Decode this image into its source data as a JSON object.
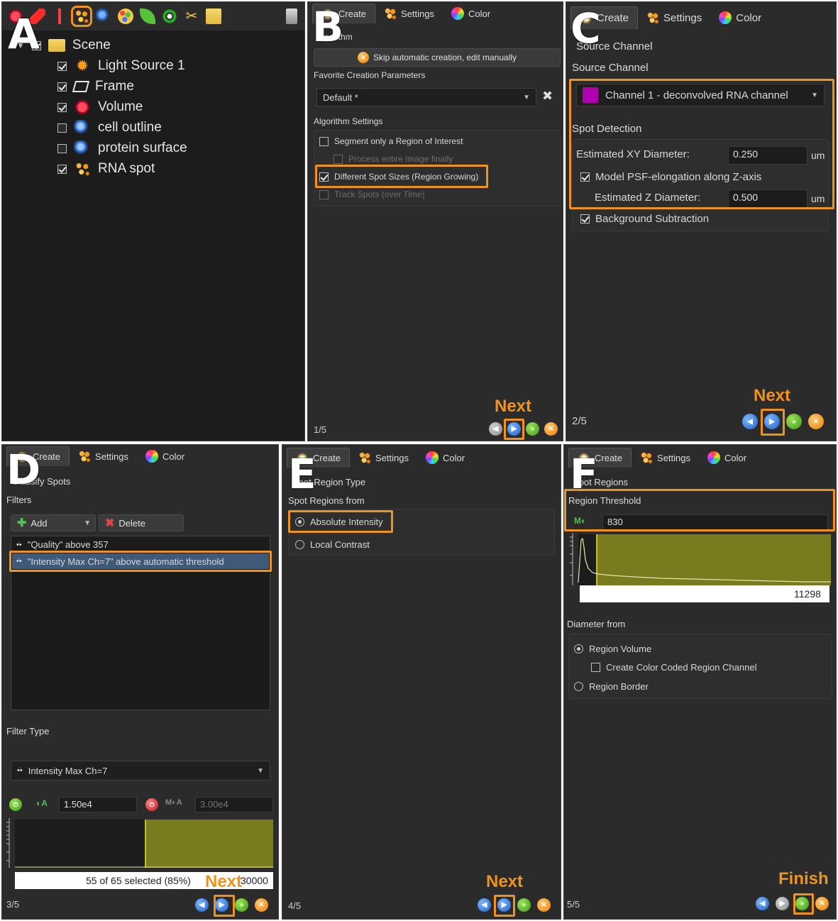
{
  "panels": {
    "A": {
      "letter": "A",
      "scene_label": "Scene",
      "tree": [
        {
          "label": "Light Source 1",
          "checked": true,
          "icon": "light-source-icon"
        },
        {
          "label": "Frame",
          "checked": true,
          "icon": "frame-icon"
        },
        {
          "label": "Volume",
          "checked": true,
          "icon": "volume-icon"
        },
        {
          "label": "cell outline",
          "checked": false,
          "icon": "surface-icon"
        },
        {
          "label": "protein surface",
          "checked": false,
          "icon": "surface-icon"
        },
        {
          "label": "RNA spot",
          "checked": true,
          "icon": "spots-icon"
        }
      ]
    },
    "tabs": {
      "create": "Create",
      "settings": "Settings",
      "color": "Color"
    },
    "B": {
      "letter": "B",
      "algorithm_title": "Algorithm",
      "skip_button": "Skip automatic creation, edit manually",
      "favorite_title": "Favorite Creation Parameters",
      "favorite_value": "Default *",
      "algo_settings_title": "Algorithm Settings",
      "opt_roi": "Segment only a Region of Interest",
      "opt_process": "Process entire Image finally",
      "opt_diff": "Different Spot Sizes (Region Growing)",
      "opt_track": "Track Spots (over Time)",
      "step": "1/5",
      "next_label": "Next"
    },
    "C": {
      "letter": "C",
      "source_title_1": "Source Channel",
      "source_title_2": "Source Channel",
      "channel_value": "Channel 1 - deconvolved RNA channel",
      "channel_color": "#b000b0",
      "spot_detection_title": "Spot Detection",
      "xy_label": "Estimated XY Diameter:",
      "xy_value": "0.250",
      "xy_unit": "um",
      "psf_label": "Model PSF-elongation along Z-axis",
      "z_label": "Estimated Z Diameter:",
      "z_value": "0.500",
      "z_unit": "um",
      "bg_label": "Background Subtraction",
      "step": "2/5",
      "next_label": "Next"
    },
    "D": {
      "letter": "D",
      "classify_title": "Classify Spots",
      "filters_title": "Filters",
      "add_label": "Add",
      "delete_label": "Delete",
      "filter_1": "\"Quality\" above 357",
      "filter_2": "\"Intensity Max Ch=7\" above automatic threshold",
      "filter_type_title": "Filter Type",
      "filter_type_value": "Intensity Max Ch=7",
      "low_value": "1.50e4",
      "high_value": "3.00e4",
      "selected_text": "55 of 65 selected (85%)",
      "max_value": "30000",
      "step": "3/5",
      "next_label": "Next"
    },
    "E": {
      "letter": "E",
      "region_type_title": "Spot Region Type",
      "regions_from_title": "Spot Regions from",
      "opt_absolute": "Absolute Intensity",
      "opt_local": "Local Contrast",
      "step": "4/5",
      "next_label": "Next"
    },
    "F": {
      "letter": "F",
      "spot_regions_title": "Spot Regions",
      "threshold_title": "Region Threshold",
      "threshold_value": "830",
      "max_value": "11298",
      "diameter_title": "Diameter from",
      "opt_volume": "Region Volume",
      "opt_color_coded": "Create Color Coded Region Channel",
      "opt_border": "Region Border",
      "step": "5/5",
      "finish_label": "Finish"
    }
  },
  "colors": {
    "highlight": "#f0931e",
    "histogram_fill": "#7a7a1e",
    "panel_bg": "#2b2b2b"
  }
}
